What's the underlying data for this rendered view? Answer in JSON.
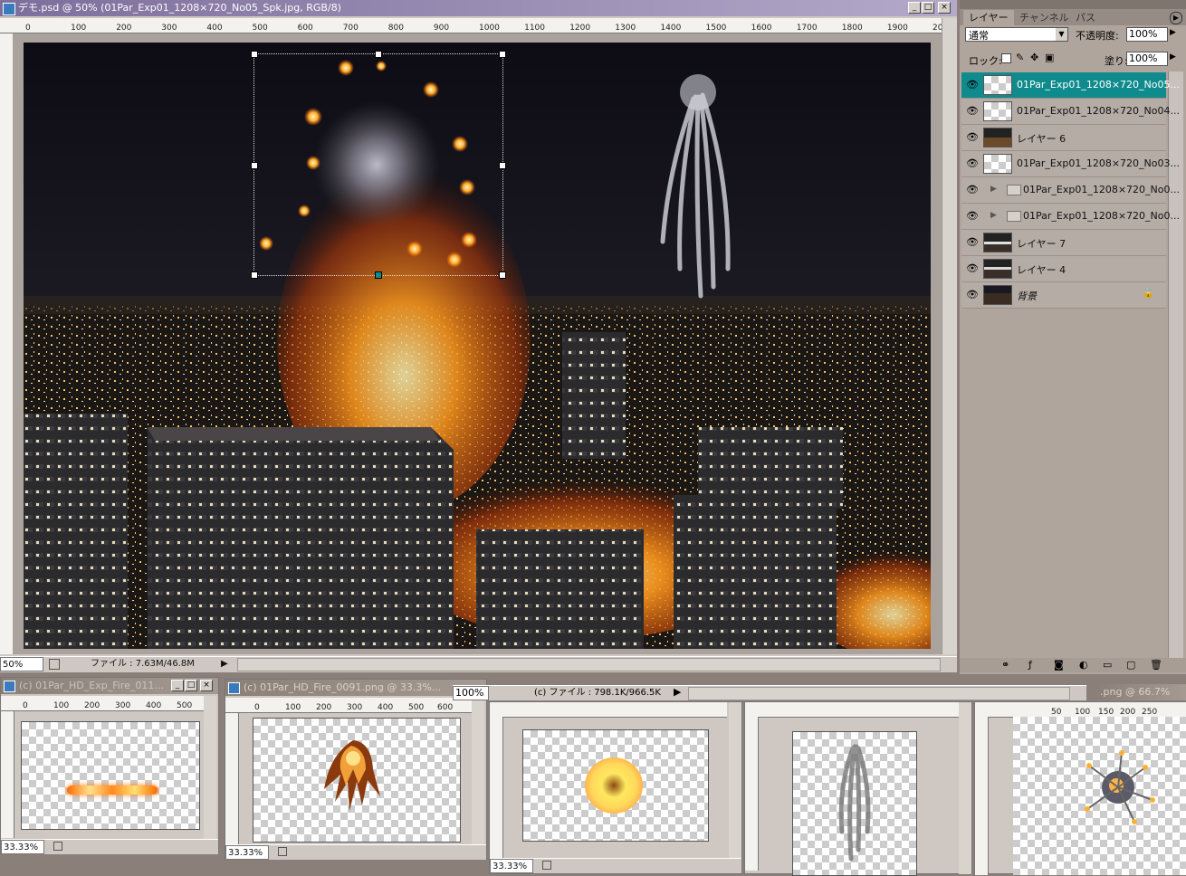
{
  "main_window": {
    "title": "デモ.psd @ 50% (01Par_Exp01_1208×720_No05_Spk.jpg, RGB/8)",
    "zoom": "50%",
    "file_info": "ファイル : 7.63M/46.8M",
    "ruler_ticks": [
      "0",
      "100",
      "200",
      "300",
      "400",
      "500",
      "600",
      "700",
      "800",
      "900",
      "1000",
      "1100",
      "1200",
      "1300",
      "1400",
      "1500",
      "1600",
      "1700",
      "1800",
      "1900",
      "20"
    ],
    "buttons": {
      "minimize": "_",
      "maximize": "□",
      "close": "×"
    }
  },
  "layers_palette": {
    "tabs": [
      "レイヤー",
      "チャンネル",
      "パス"
    ],
    "blend_mode": "通常",
    "opacity_label": "不透明度:",
    "opacity_value": "100%",
    "lock_label": "ロック:",
    "fill_label": "塗り:",
    "fill_value": "100%",
    "layers": [
      {
        "name": "01Par_Exp01_1208×720_No05...",
        "type": "layer",
        "selected": true
      },
      {
        "name": "01Par_Exp01_1208×720_No04...",
        "type": "layer",
        "selected": false
      },
      {
        "name": "レイヤー 6",
        "type": "layer",
        "selected": false
      },
      {
        "name": "01Par_Exp01_1208×720_No03...",
        "type": "layer",
        "selected": false
      },
      {
        "name": "01Par_Exp01_1208×720_No0...",
        "type": "group",
        "selected": false
      },
      {
        "name": "01Par_Exp01_1208×720_No0...",
        "type": "group",
        "selected": false
      },
      {
        "name": "レイヤー 7",
        "type": "layer",
        "selected": false
      },
      {
        "name": "レイヤー 4",
        "type": "layer",
        "selected": false
      },
      {
        "name": "背景",
        "type": "background",
        "selected": false
      }
    ]
  },
  "doc_windows": [
    {
      "title": "(c) 01Par_HD_Exp_Fire_011...",
      "zoom": "33.33%",
      "ruler": [
        "0",
        "100",
        "200",
        "300",
        "400",
        "500"
      ]
    },
    {
      "title": "(c) 01Par_HD_Fire_0091.png @ 33.3%...",
      "zoom": "33.33%",
      "ruler": [
        "0",
        "100",
        "200",
        "300",
        "400",
        "500",
        "600"
      ]
    },
    {
      "title": "",
      "zoom": "100%",
      "file_info": "(c) ファイル : 798.1K/966.5K"
    },
    {
      "title": "",
      "zoom": "33.33%"
    },
    {
      "title": "",
      "zoom": ""
    },
    {
      "title": ".png @ 66.7% (RGB/8)",
      "zoom": "",
      "ruler": [
        "50",
        "100",
        "150",
        "200",
        "250"
      ]
    }
  ]
}
